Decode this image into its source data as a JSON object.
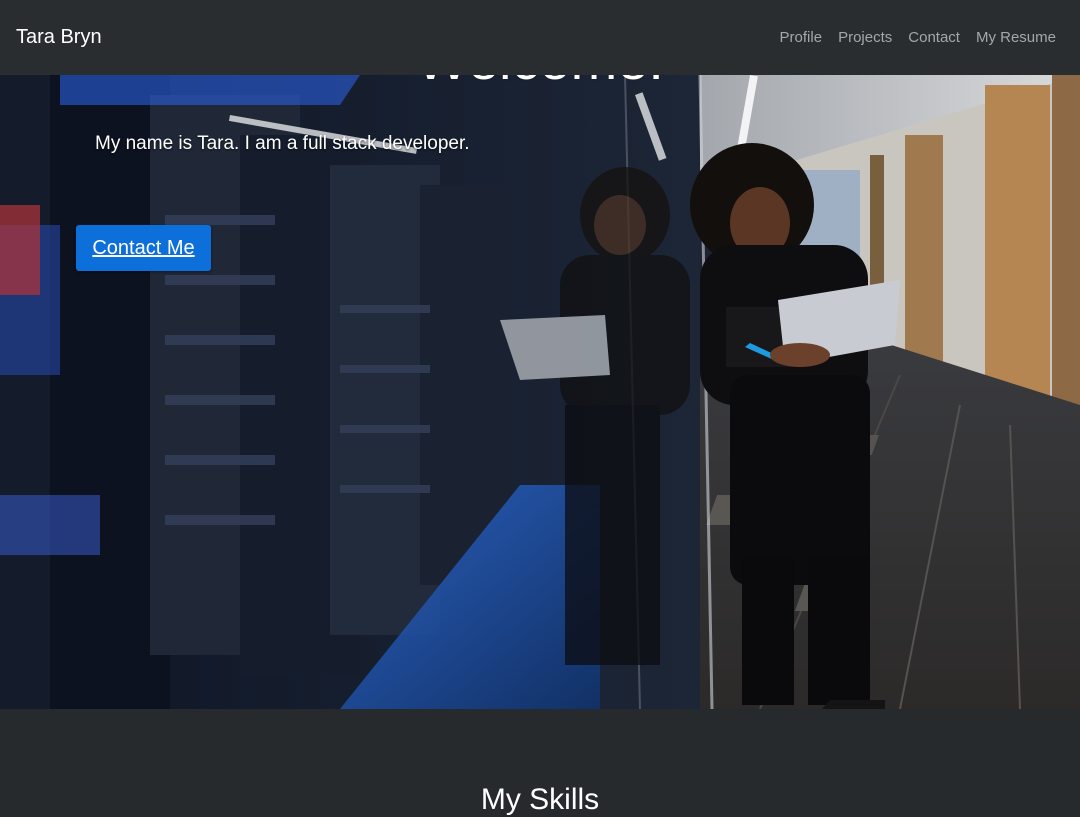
{
  "navbar": {
    "brand": "Tara Bryn",
    "links": [
      "Profile",
      "Projects",
      "Contact",
      "My Resume"
    ]
  },
  "hero": {
    "title": "Welcome!",
    "subtitle": "My name is Tara. I am a full stack developer.",
    "cta_label": "Contact Me",
    "image_description_icon": "server-room-photo"
  },
  "skills": {
    "title": "My Skills"
  },
  "colors": {
    "navbar_bg": "#2a2d30",
    "page_bg": "#272a2d",
    "button_bg": "#0d6fd9",
    "nav_link": "#a3a7ab"
  }
}
